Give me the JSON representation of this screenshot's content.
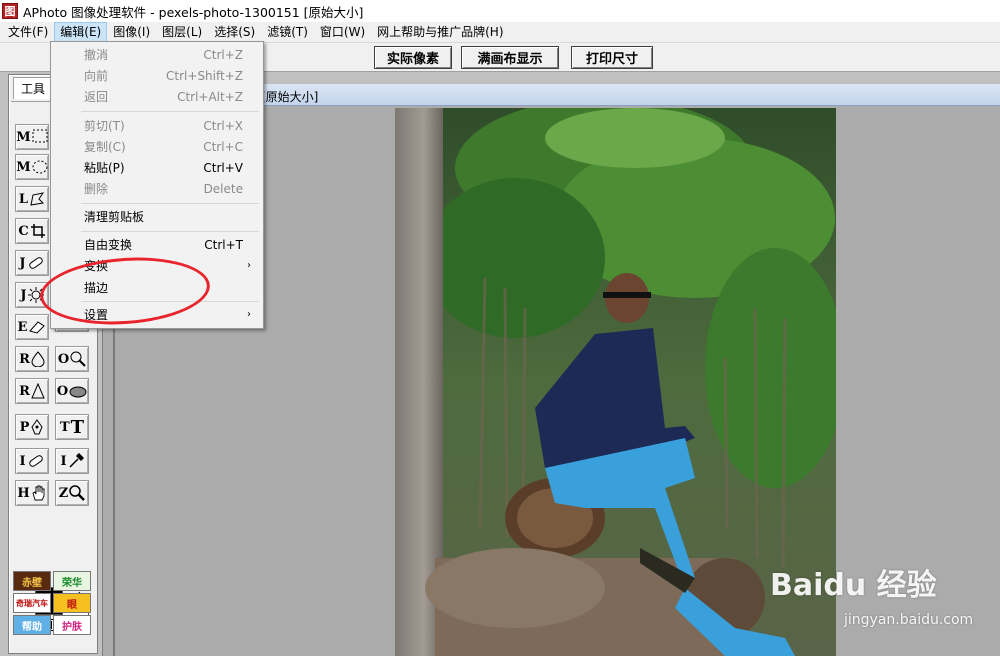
{
  "window": {
    "app_icon": "图",
    "title": "APhoto 图像处理软件 - pexels-photo-1300151 [原始大小]"
  },
  "menubar": [
    {
      "label": "文件(F)",
      "active": false
    },
    {
      "label": "编辑(E)",
      "active": true
    },
    {
      "label": "图像(I)",
      "active": false
    },
    {
      "label": "图层(L)",
      "active": false
    },
    {
      "label": "选择(S)",
      "active": false
    },
    {
      "label": "滤镜(T)",
      "active": false
    },
    {
      "label": "窗口(W)",
      "active": false
    },
    {
      "label": "网上帮助与推广品牌(H)",
      "active": false
    }
  ],
  "toolbar": {
    "actual_pixels": "实际像素",
    "fit_canvas": "满画布显示",
    "print_size": "打印尺寸"
  },
  "toolpanel": {
    "tab_label": "工具",
    "tools": [
      {
        "name": "rect-marquee-tool",
        "letter": "M",
        "icon": "rect-select-icon"
      },
      {
        "name": "ellipse-marquee-tool",
        "letter": "M",
        "icon": "ellipse-select-icon"
      },
      {
        "name": "lasso-tool",
        "letter": "L",
        "icon": "lasso-icon"
      },
      {
        "name": "crop-tool",
        "letter": "C",
        "icon": "crop-icon"
      },
      {
        "name": "healing-brush-tool",
        "letter": "J",
        "icon": "bandage-icon"
      },
      {
        "name": "spot-heal-tool",
        "letter": "J",
        "icon": "sun-icon"
      },
      {
        "name": "eraser-tool",
        "letter": "E",
        "icon": "eraser-icon"
      },
      {
        "name": "blur-tool",
        "letter": "R",
        "icon": "drop-icon"
      },
      {
        "name": "dodge-tool",
        "letter": "O",
        "icon": "dodge-icon"
      },
      {
        "name": "sharpen-tool",
        "letter": "R",
        "icon": "triangle-icon"
      },
      {
        "name": "sponge-tool",
        "letter": "O",
        "icon": "sponge-icon"
      },
      {
        "name": "pen-tool",
        "letter": "P",
        "icon": "pen-icon"
      },
      {
        "name": "text-tool",
        "letter": "T",
        "icon": "text-icon"
      },
      {
        "name": "bandage-tool-2",
        "letter": "I",
        "icon": "bandage-icon"
      },
      {
        "name": "eyedropper-tool",
        "letter": "I",
        "icon": "eyedropper-icon"
      },
      {
        "name": "hand-tool",
        "letter": "H",
        "icon": "hand-icon"
      },
      {
        "name": "zoom-tool",
        "letter": "Z",
        "icon": "magnifier-icon"
      }
    ],
    "colors": {
      "foreground": "#000000",
      "background": "#ffffff"
    },
    "ads": [
      "赤壁",
      "荣华",
      "奇瑞汽车",
      "眼",
      "帮助",
      "护肤"
    ]
  },
  "document": {
    "title_fragment": "[原始大小]"
  },
  "edit_menu": {
    "items": [
      {
        "label": "撤消",
        "shortcut": "Ctrl+Z",
        "disabled": true
      },
      {
        "label": "向前",
        "shortcut": "Ctrl+Shift+Z",
        "disabled": true
      },
      {
        "label": "返回",
        "shortcut": "Ctrl+Alt+Z",
        "disabled": true
      },
      {
        "label": "剪切(T)",
        "shortcut": "Ctrl+X",
        "disabled": true
      },
      {
        "label": "复制(C)",
        "shortcut": "Ctrl+C",
        "disabled": true
      },
      {
        "label": "粘贴(P)",
        "shortcut": "Ctrl+V",
        "disabled": false
      },
      {
        "label": "删除",
        "shortcut": "Delete",
        "disabled": true
      },
      {
        "label": "清理剪贴板",
        "shortcut": "",
        "disabled": false
      },
      {
        "label": "自由变换",
        "shortcut": "Ctrl+T",
        "disabled": false
      },
      {
        "label": "变换",
        "shortcut": "",
        "disabled": false,
        "submenu": true
      },
      {
        "label": "描边",
        "shortcut": "",
        "disabled": false
      },
      {
        "label": "设置",
        "shortcut": "",
        "disabled": false,
        "submenu": true
      }
    ],
    "annotation_color": "#e8242c"
  },
  "watermark": {
    "main": "Baidu 经验",
    "sub": "jingyan.baidu.com"
  }
}
